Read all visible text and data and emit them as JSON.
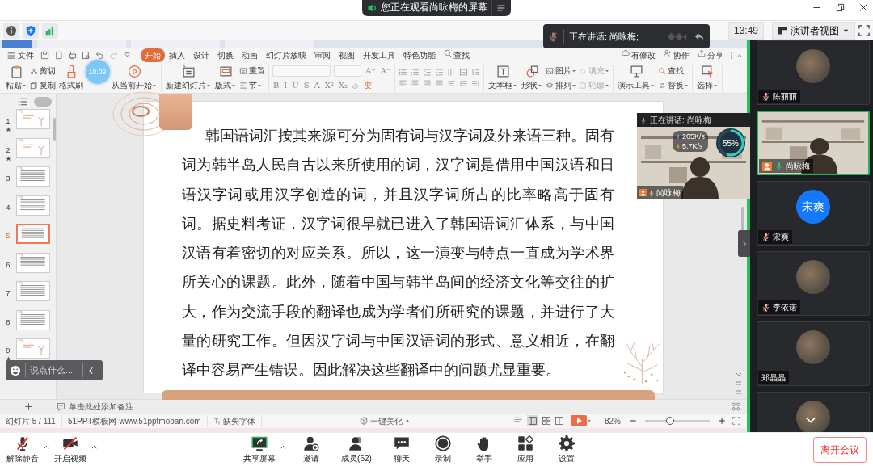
{
  "share_banner": {
    "text": "您正在观看尚咏梅的屏幕"
  },
  "meeting_bar": {
    "time": "13:49",
    "view_button": "演讲者视图"
  },
  "speaking_toast": {
    "text": "正在讲话: 尚咏梅;"
  },
  "presentation": {
    "document_tabs": [
      {
        "selected": true
      },
      {
        "selected": false
      },
      {
        "selected": false
      },
      {
        "selected": false
      }
    ],
    "file_menu": "文件",
    "tabs": [
      {
        "label": "开始",
        "selected": true
      },
      {
        "label": "插入",
        "selected": false
      },
      {
        "label": "设计",
        "selected": false
      },
      {
        "label": "切换",
        "selected": false
      },
      {
        "label": "动画",
        "selected": false
      },
      {
        "label": "幻灯片放映",
        "selected": false
      },
      {
        "label": "审阅",
        "selected": false
      },
      {
        "label": "视图",
        "selected": false
      },
      {
        "label": "开发工具",
        "selected": false
      },
      {
        "label": "特色功能",
        "selected": false
      }
    ],
    "search": "查找",
    "actions": [
      "有修改",
      "协作",
      "分享"
    ],
    "ribbon": [
      {
        "kind": "tools",
        "columns": [
          {
            "items": [
              {
                "label": "粘贴",
                "dropdown": true,
                "disabled": false
              }
            ]
          },
          {
            "items": [
              {
                "label": "剪切",
                "dropdown": false,
                "disabled": false
              },
              {
                "label": "复制",
                "dropdown": false,
                "disabled": false
              }
            ]
          },
          {
            "items": [
              {
                "label": "格式刷",
                "dropdown": false,
                "disabled": false
              }
            ]
          },
          {
            "items": [
              {
                "label": "从当前开始",
                "dropdown": true,
                "disabled": false
              }
            ]
          }
        ]
      },
      {
        "kind": "tools",
        "columns": [
          {
            "items": [
              {
                "label": "新建幻灯片",
                "dropdown": true,
                "disabled": false
              }
            ]
          },
          {
            "items": [
              {
                "label": "版式",
                "dropdown": true,
                "disabled": false
              }
            ]
          },
          {
            "items": [
              {
                "label": "重置",
                "dropdown": false,
                "disabled": false
              },
              {
                "label": "节",
                "dropdown": true,
                "disabled": false
              }
            ]
          }
        ]
      },
      {
        "kind": "font",
        "size_buttons": [
          "A⁺",
          "A⁻"
        ],
        "format_buttons": [
          "B",
          "I",
          "U",
          "S",
          "A",
          "X²",
          "X₂"
        ],
        "transform_button": "变"
      },
      {
        "kind": "paragraph"
      },
      {
        "kind": "tools",
        "columns": [
          {
            "items": [
              {
                "label": "文本框",
                "dropdown": true,
                "disabled": false
              }
            ]
          },
          {
            "items": [
              {
                "label": "形状",
                "dropdown": true,
                "disabled": false
              }
            ]
          },
          {
            "items": [
              {
                "label": "图片",
                "dropdown": true,
                "disabled": false
              },
              {
                "label": "排列",
                "dropdown": true,
                "disabled": false
              }
            ]
          },
          {
            "items": [
              {
                "label": "填充",
                "dropdown": true,
                "disabled": true
              },
              {
                "label": "轮廓",
                "dropdown": true,
                "disabled": true
              }
            ]
          }
        ]
      },
      {
        "kind": "tools",
        "columns": [
          {
            "items": [
              {
                "label": "演示工具",
                "dropdown": true,
                "disabled": false
              }
            ]
          },
          {
            "items": [
              {
                "label": "查找",
                "dropdown": false,
                "disabled": false
              },
              {
                "label": "替换",
                "dropdown": true,
                "disabled": false
              }
            ]
          }
        ]
      },
      {
        "kind": "tools",
        "columns": [
          {
            "items": [
              {
                "label": "选择",
                "dropdown": true,
                "disabled": false
              }
            ]
          }
        ]
      }
    ],
    "timer": "10:09",
    "slides": [
      {
        "number": "1",
        "kind": "cover",
        "selected": false,
        "animated": true
      },
      {
        "number": "2",
        "kind": "cover",
        "selected": false,
        "animated": true
      },
      {
        "number": "3",
        "kind": "text",
        "selected": false,
        "animated": false
      },
      {
        "number": "4",
        "kind": "text",
        "selected": false,
        "animated": false
      },
      {
        "number": "5",
        "kind": "text",
        "selected": true,
        "animated": false
      },
      {
        "number": "6",
        "kind": "text",
        "selected": false,
        "animated": false
      },
      {
        "number": "7",
        "kind": "text",
        "selected": false,
        "animated": false
      },
      {
        "number": "8",
        "kind": "text",
        "selected": false,
        "animated": false
      },
      {
        "number": "9",
        "kind": "cover",
        "selected": false,
        "animated": true
      }
    ],
    "slide_text": "韩国语词汇按其来源可分为固有词与汉字词及外来语三种。固有词为韩半岛人民自古以来所使用的词，汉字词是借用中国汉语和日语汉字词或用汉字创造的词，并且汉字词所占的比率略高于固有词。据史料考证，汉字词很早就已进入了韩国语词汇体系，与中国汉语有着密切的对应关系。所以，这一演变与特点一直成为学术界所关心的课题。此外，随着中国与韩半岛间的经济文化等交往的扩大，作为交流手段的翻译也成为学者们所研究的课题，并进行了大量的研究工作。但因汉字词与中国汉语词的形式、意义相近，在翻译中容易产生错误。因此解决这些翻译中的问题尤显重要。",
    "notes_placeholder": "单击此处添加备注",
    "status": {
      "slide_counter": "幻灯片 5 / 111",
      "template": "51PPT模板网",
      "website": "www.51pptmoban.com",
      "missing_font": "缺失字体",
      "beautify": "一键美化",
      "zoom": "82%"
    },
    "zoom_slider": {
      "level": 0.39
    }
  },
  "chat_bar": {
    "placeholder": "说点什么..."
  },
  "floating_video": {
    "speaking": "正在讲话: 尚咏梅",
    "upload": "265K/s",
    "download": "5.7K/s",
    "usage": {
      "reading": "55%",
      "level": 0.55
    },
    "name": "尚咏梅"
  },
  "participants": [
    {
      "name": "陈丽丽",
      "kind": "photo",
      "mic_icon": true,
      "muted": true,
      "host": false,
      "active": false
    },
    {
      "name": "尚咏梅",
      "kind": "video",
      "mic_icon": true,
      "muted": false,
      "host": true,
      "active": true
    },
    {
      "name": "宋爽",
      "kind": "initials",
      "initials": "宋爽",
      "mic_icon": true,
      "muted": true,
      "host": false,
      "active": false
    },
    {
      "name": "李依诺",
      "kind": "photo",
      "mic_icon": true,
      "muted": true,
      "host": false,
      "active": false
    },
    {
      "name": "郑晶晶",
      "kind": "photo",
      "mic_icon": false,
      "host": false,
      "active": false
    },
    {
      "kind": "photo",
      "mic_icon": false,
      "host": false,
      "active": false
    }
  ],
  "toolbar": [
    {
      "label": "解除静音",
      "kind": "mic-off",
      "menu": true
    },
    {
      "label": "开启视频",
      "kind": "video-off",
      "menu": true
    },
    {
      "label": "共享屏幕",
      "kind": "share",
      "menu": true
    },
    {
      "label": "邀请",
      "kind": "invite",
      "menu": false
    },
    {
      "label": "成员(62)",
      "kind": "members",
      "menu": false
    },
    {
      "label": "聊天",
      "kind": "chat",
      "menu": false
    },
    {
      "label": "录制",
      "kind": "record",
      "menu": false
    },
    {
      "label": "举手",
      "kind": "hand",
      "menu": false
    },
    {
      "label": "应用",
      "kind": "apps",
      "menu": false
    },
    {
      "label": "设置",
      "kind": "settings",
      "menu": false
    }
  ],
  "leave_button": "离开会议"
}
